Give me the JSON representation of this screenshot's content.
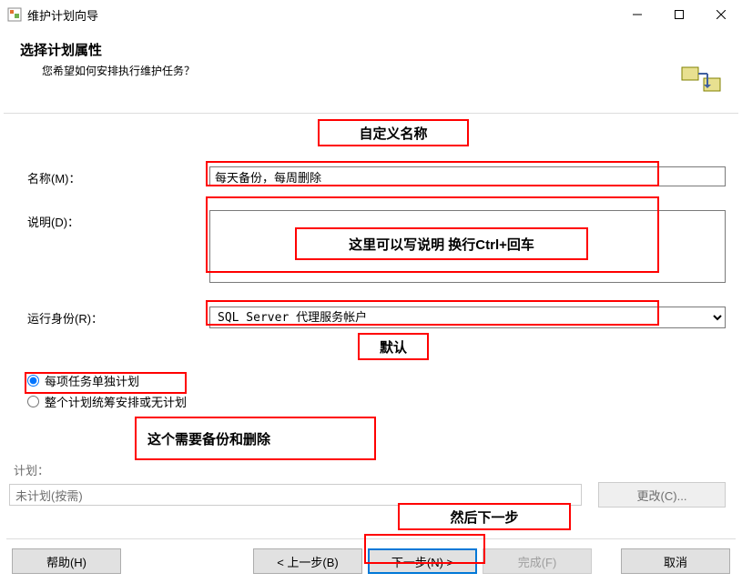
{
  "window": {
    "title": "维护计划向导"
  },
  "header": {
    "title": "选择计划属性",
    "subtitle": "您希望如何安排执行维护任务？"
  },
  "form": {
    "name_label": "名称(M)：",
    "name_value": "每天备份，每周删除",
    "desc_label": "说明(D)：",
    "desc_value": "",
    "runas_label": "运行身份(R)：",
    "runas_value": "SQL Server 代理服务帐户"
  },
  "radio": {
    "opt1": "每项任务单独计划",
    "opt2": "整个计划统筹安排或无计划"
  },
  "plan": {
    "label": "计划：",
    "value": "未计划(按需)",
    "change_btn": "更改(C)..."
  },
  "buttons": {
    "help": "帮助(H)",
    "back": "< 上一步(B)",
    "next": "下一步(N) >",
    "finish": "完成(F)",
    "cancel": "取消"
  },
  "annotations": {
    "a1": "自定义名称",
    "a2": "这里可以写说明 换行Ctrl+回车",
    "a3": "默认",
    "a4": "这个需要备份和删除",
    "a5": "然后下一步"
  }
}
